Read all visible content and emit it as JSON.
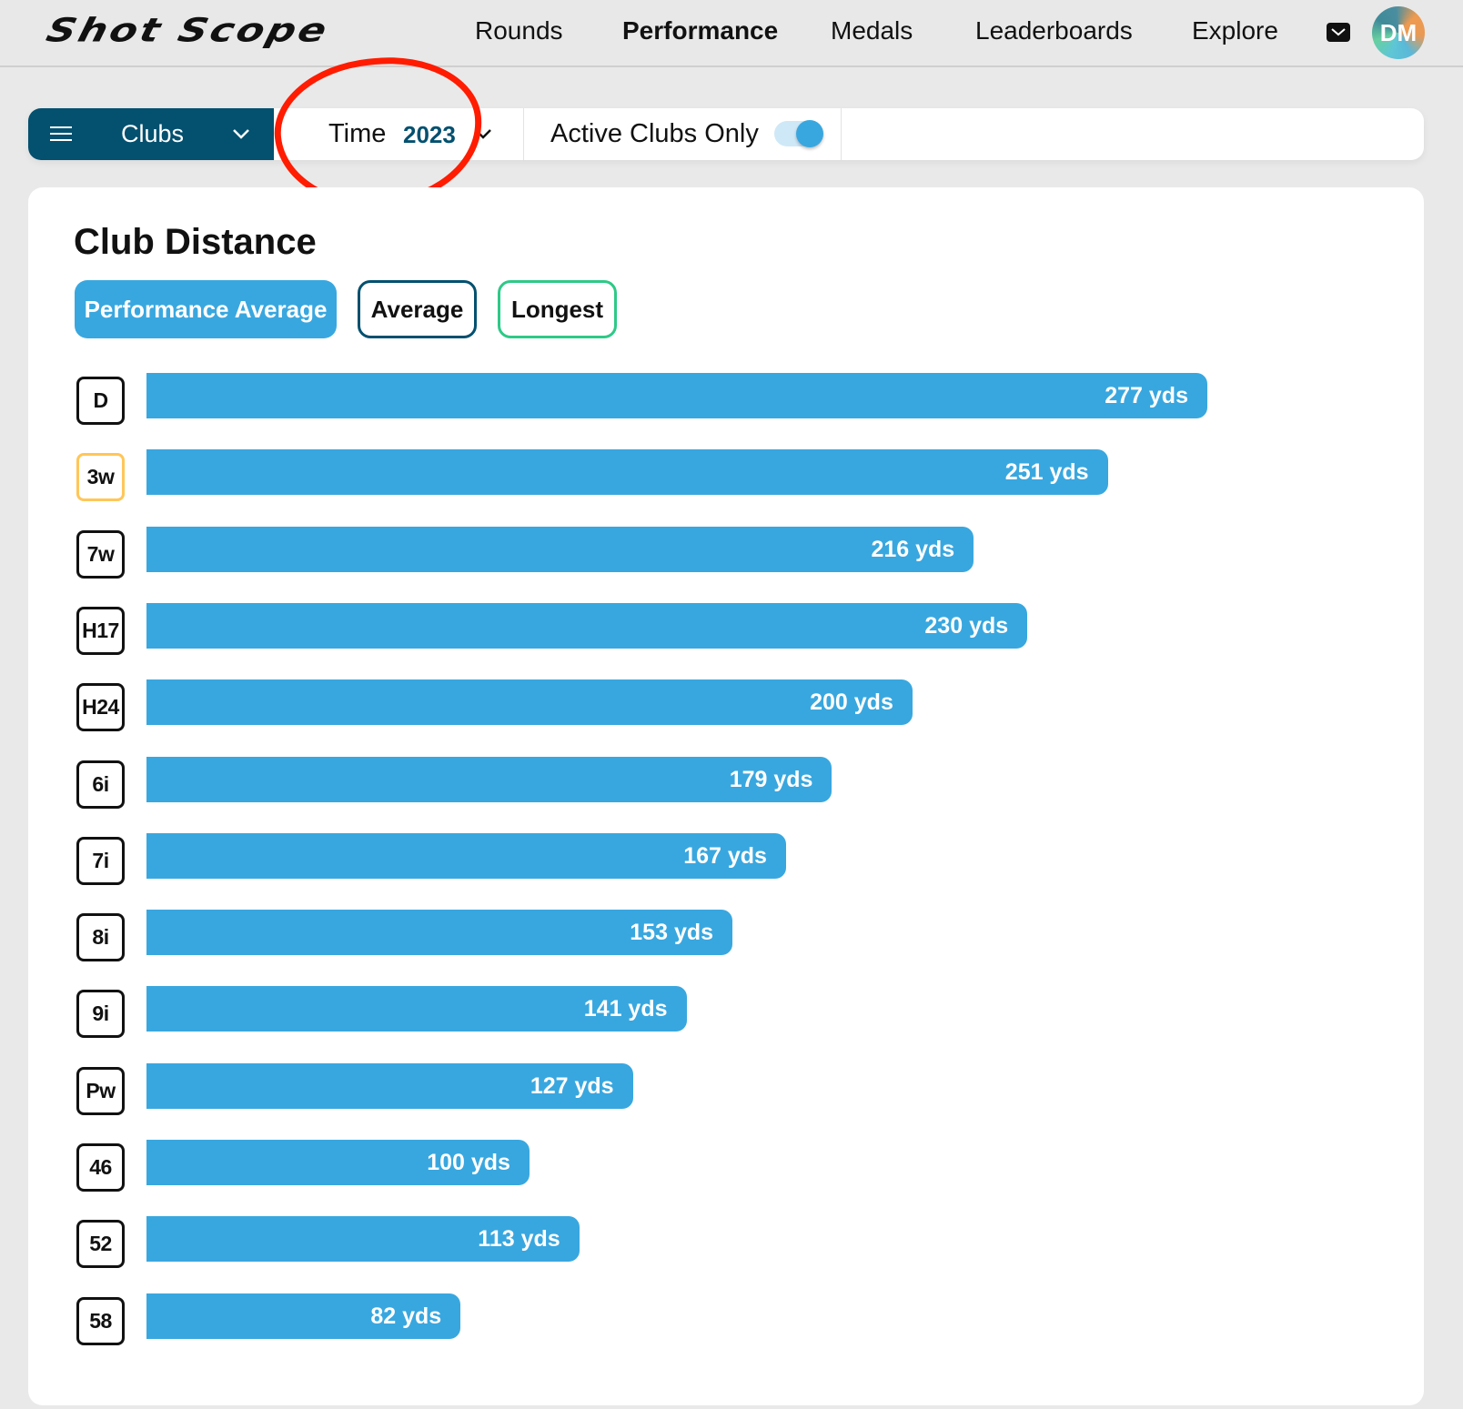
{
  "nav": {
    "logo": "Shot Scope",
    "items": [
      {
        "label": "Rounds",
        "active": false
      },
      {
        "label": "Performance",
        "active": true
      },
      {
        "label": "Medals",
        "active": false
      },
      {
        "label": "Leaderboards",
        "active": false
      },
      {
        "label": "Explore",
        "active": false
      }
    ],
    "mail_icon": "envelope-icon",
    "avatar_initials": "DM"
  },
  "filters": {
    "section_dropdown": {
      "label": "Clubs",
      "icon": "hamburger-menu-icon"
    },
    "time": {
      "label": "Time",
      "value": "2023"
    },
    "active_clubs_only": {
      "label": "Active Clubs Only",
      "on": true
    }
  },
  "card": {
    "title": "Club Distance",
    "metric_buttons": [
      {
        "label": "Performance Average",
        "selected": true
      },
      {
        "label": "Average",
        "selected": false
      },
      {
        "label": "Longest",
        "selected": false
      }
    ]
  },
  "colors": {
    "bar": "#39a7df",
    "primary_dark": "#03506f",
    "longest_accent": "#2ec987",
    "highlight_badge": "#ffc658",
    "annotation": "#ff1c00"
  },
  "chart_data": {
    "type": "bar",
    "orientation": "horizontal",
    "title": "Club Distance",
    "metric": "Performance Average",
    "unit": "yds",
    "categories": [
      "D",
      "3w",
      "7w",
      "H17",
      "H24",
      "6i",
      "7i",
      "8i",
      "9i",
      "Pw",
      "46",
      "52",
      "58"
    ],
    "values": [
      277,
      251,
      216,
      230,
      200,
      179,
      167,
      153,
      141,
      127,
      100,
      113,
      82
    ],
    "value_labels": [
      "277 yds",
      "251 yds",
      "216 yds",
      "230 yds",
      "200 yds",
      "179 yds",
      "167 yds",
      "153 yds",
      "141 yds",
      "127 yds",
      "100 yds",
      "113 yds",
      "82 yds"
    ],
    "highlighted": [
      "3w"
    ],
    "xlim": [
      0,
      277
    ],
    "grid": false,
    "legend": "none"
  }
}
